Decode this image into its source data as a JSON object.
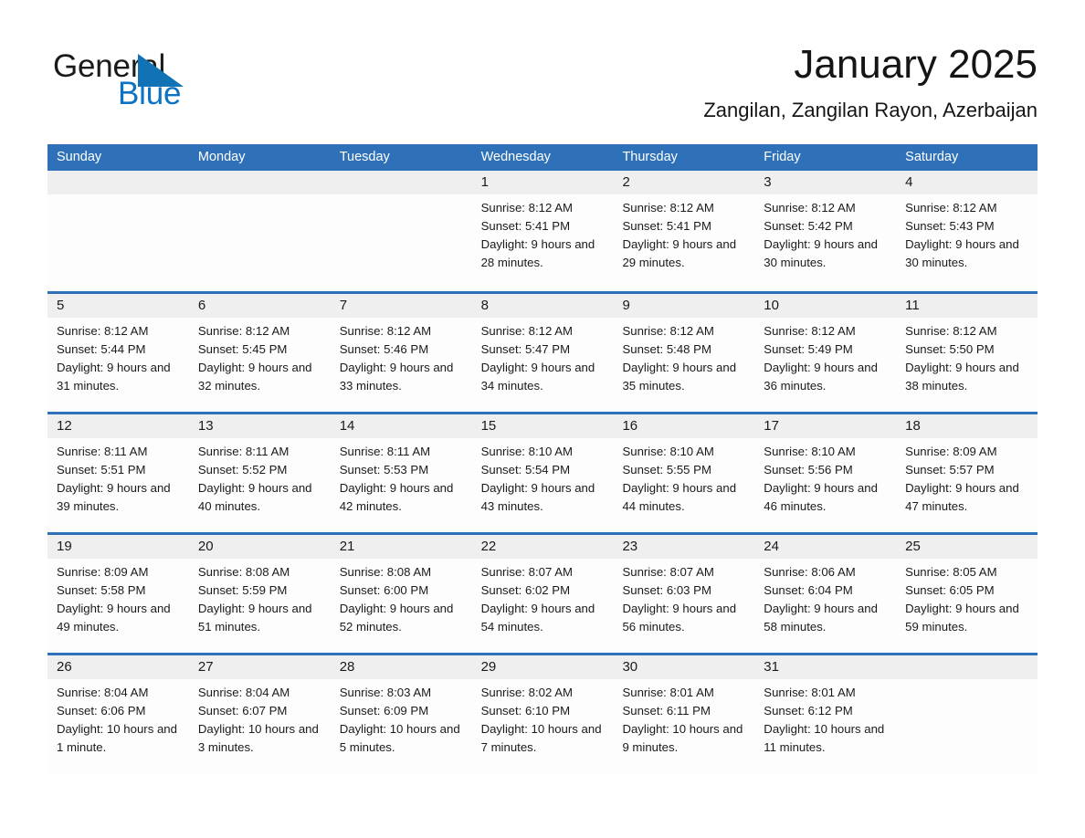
{
  "brand": {
    "name_part1": "General",
    "name_part2": "Blue",
    "triangle_color": "#1272b6",
    "blue_color": "#0b72c4"
  },
  "header": {
    "month_title": "January 2025",
    "location": "Zangilan, Zangilan Rayon, Azerbaijan"
  },
  "theme": {
    "header_blue": "#2e71b8",
    "daynum_gray": "#efefef",
    "cell_bg": "#fdfdfd"
  },
  "calendar": {
    "weekday_headers": [
      "Sunday",
      "Monday",
      "Tuesday",
      "Wednesday",
      "Thursday",
      "Friday",
      "Saturday"
    ],
    "weeks": [
      [
        {
          "day": "",
          "sunrise": "",
          "sunset": "",
          "daylight": ""
        },
        {
          "day": "",
          "sunrise": "",
          "sunset": "",
          "daylight": ""
        },
        {
          "day": "",
          "sunrise": "",
          "sunset": "",
          "daylight": ""
        },
        {
          "day": "1",
          "sunrise": "Sunrise: 8:12 AM",
          "sunset": "Sunset: 5:41 PM",
          "daylight": "Daylight: 9 hours and 28 minutes."
        },
        {
          "day": "2",
          "sunrise": "Sunrise: 8:12 AM",
          "sunset": "Sunset: 5:41 PM",
          "daylight": "Daylight: 9 hours and 29 minutes."
        },
        {
          "day": "3",
          "sunrise": "Sunrise: 8:12 AM",
          "sunset": "Sunset: 5:42 PM",
          "daylight": "Daylight: 9 hours and 30 minutes."
        },
        {
          "day": "4",
          "sunrise": "Sunrise: 8:12 AM",
          "sunset": "Sunset: 5:43 PM",
          "daylight": "Daylight: 9 hours and 30 minutes."
        }
      ],
      [
        {
          "day": "5",
          "sunrise": "Sunrise: 8:12 AM",
          "sunset": "Sunset: 5:44 PM",
          "daylight": "Daylight: 9 hours and 31 minutes."
        },
        {
          "day": "6",
          "sunrise": "Sunrise: 8:12 AM",
          "sunset": "Sunset: 5:45 PM",
          "daylight": "Daylight: 9 hours and 32 minutes."
        },
        {
          "day": "7",
          "sunrise": "Sunrise: 8:12 AM",
          "sunset": "Sunset: 5:46 PM",
          "daylight": "Daylight: 9 hours and 33 minutes."
        },
        {
          "day": "8",
          "sunrise": "Sunrise: 8:12 AM",
          "sunset": "Sunset: 5:47 PM",
          "daylight": "Daylight: 9 hours and 34 minutes."
        },
        {
          "day": "9",
          "sunrise": "Sunrise: 8:12 AM",
          "sunset": "Sunset: 5:48 PM",
          "daylight": "Daylight: 9 hours and 35 minutes."
        },
        {
          "day": "10",
          "sunrise": "Sunrise: 8:12 AM",
          "sunset": "Sunset: 5:49 PM",
          "daylight": "Daylight: 9 hours and 36 minutes."
        },
        {
          "day": "11",
          "sunrise": "Sunrise: 8:12 AM",
          "sunset": "Sunset: 5:50 PM",
          "daylight": "Daylight: 9 hours and 38 minutes."
        }
      ],
      [
        {
          "day": "12",
          "sunrise": "Sunrise: 8:11 AM",
          "sunset": "Sunset: 5:51 PM",
          "daylight": "Daylight: 9 hours and 39 minutes."
        },
        {
          "day": "13",
          "sunrise": "Sunrise: 8:11 AM",
          "sunset": "Sunset: 5:52 PM",
          "daylight": "Daylight: 9 hours and 40 minutes."
        },
        {
          "day": "14",
          "sunrise": "Sunrise: 8:11 AM",
          "sunset": "Sunset: 5:53 PM",
          "daylight": "Daylight: 9 hours and 42 minutes."
        },
        {
          "day": "15",
          "sunrise": "Sunrise: 8:10 AM",
          "sunset": "Sunset: 5:54 PM",
          "daylight": "Daylight: 9 hours and 43 minutes."
        },
        {
          "day": "16",
          "sunrise": "Sunrise: 8:10 AM",
          "sunset": "Sunset: 5:55 PM",
          "daylight": "Daylight: 9 hours and 44 minutes."
        },
        {
          "day": "17",
          "sunrise": "Sunrise: 8:10 AM",
          "sunset": "Sunset: 5:56 PM",
          "daylight": "Daylight: 9 hours and 46 minutes."
        },
        {
          "day": "18",
          "sunrise": "Sunrise: 8:09 AM",
          "sunset": "Sunset: 5:57 PM",
          "daylight": "Daylight: 9 hours and 47 minutes."
        }
      ],
      [
        {
          "day": "19",
          "sunrise": "Sunrise: 8:09 AM",
          "sunset": "Sunset: 5:58 PM",
          "daylight": "Daylight: 9 hours and 49 minutes."
        },
        {
          "day": "20",
          "sunrise": "Sunrise: 8:08 AM",
          "sunset": "Sunset: 5:59 PM",
          "daylight": "Daylight: 9 hours and 51 minutes."
        },
        {
          "day": "21",
          "sunrise": "Sunrise: 8:08 AM",
          "sunset": "Sunset: 6:00 PM",
          "daylight": "Daylight: 9 hours and 52 minutes."
        },
        {
          "day": "22",
          "sunrise": "Sunrise: 8:07 AM",
          "sunset": "Sunset: 6:02 PM",
          "daylight": "Daylight: 9 hours and 54 minutes."
        },
        {
          "day": "23",
          "sunrise": "Sunrise: 8:07 AM",
          "sunset": "Sunset: 6:03 PM",
          "daylight": "Daylight: 9 hours and 56 minutes."
        },
        {
          "day": "24",
          "sunrise": "Sunrise: 8:06 AM",
          "sunset": "Sunset: 6:04 PM",
          "daylight": "Daylight: 9 hours and 58 minutes."
        },
        {
          "day": "25",
          "sunrise": "Sunrise: 8:05 AM",
          "sunset": "Sunset: 6:05 PM",
          "daylight": "Daylight: 9 hours and 59 minutes."
        }
      ],
      [
        {
          "day": "26",
          "sunrise": "Sunrise: 8:04 AM",
          "sunset": "Sunset: 6:06 PM",
          "daylight": "Daylight: 10 hours and 1 minute."
        },
        {
          "day": "27",
          "sunrise": "Sunrise: 8:04 AM",
          "sunset": "Sunset: 6:07 PM",
          "daylight": "Daylight: 10 hours and 3 minutes."
        },
        {
          "day": "28",
          "sunrise": "Sunrise: 8:03 AM",
          "sunset": "Sunset: 6:09 PM",
          "daylight": "Daylight: 10 hours and 5 minutes."
        },
        {
          "day": "29",
          "sunrise": "Sunrise: 8:02 AM",
          "sunset": "Sunset: 6:10 PM",
          "daylight": "Daylight: 10 hours and 7 minutes."
        },
        {
          "day": "30",
          "sunrise": "Sunrise: 8:01 AM",
          "sunset": "Sunset: 6:11 PM",
          "daylight": "Daylight: 10 hours and 9 minutes."
        },
        {
          "day": "31",
          "sunrise": "Sunrise: 8:01 AM",
          "sunset": "Sunset: 6:12 PM",
          "daylight": "Daylight: 10 hours and 11 minutes."
        },
        {
          "day": "",
          "sunrise": "",
          "sunset": "",
          "daylight": ""
        }
      ]
    ]
  }
}
